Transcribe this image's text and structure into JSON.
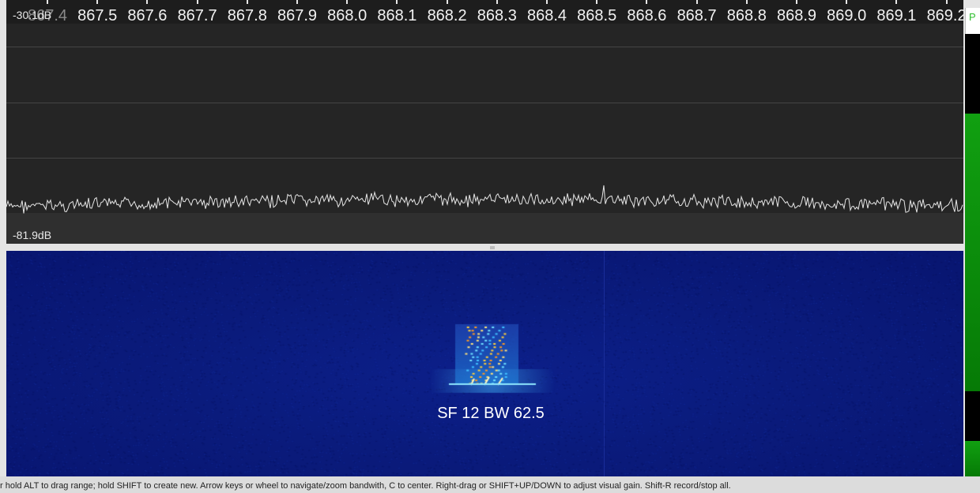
{
  "spectrum": {
    "frequency_axis": {
      "unit": "MHz",
      "labels": [
        "867.4",
        "867.5",
        "867.6",
        "867.7",
        "867.8",
        "867.9",
        "868.0",
        "868.1",
        "868.2",
        "868.3",
        "868.4",
        "868.5",
        "868.6",
        "868.7",
        "868.8",
        "868.9",
        "869.0",
        "869.1",
        "869.2"
      ]
    },
    "db_top": "-30.1dB",
    "db_bottom": "-81.9dB",
    "trace_color": "#e6e6e6"
  },
  "waterfall": {
    "overlay_label": "SF 12 BW 62.5",
    "background_color": "#0a1b7c"
  },
  "level_meter": {
    "label": "P",
    "fill_color": "#11a011",
    "level_top_fraction": 0.62,
    "level_bottom_fraction": 0.08
  },
  "status_bar": {
    "text": "r hold ALT to drag range; hold SHIFT to create new. Arrow keys or wheel to navigate/zoom bandwith, C to center. Right-drag or SHIFT+UP/DOWN to adjust visual gain. Shift-R record/stop all."
  }
}
